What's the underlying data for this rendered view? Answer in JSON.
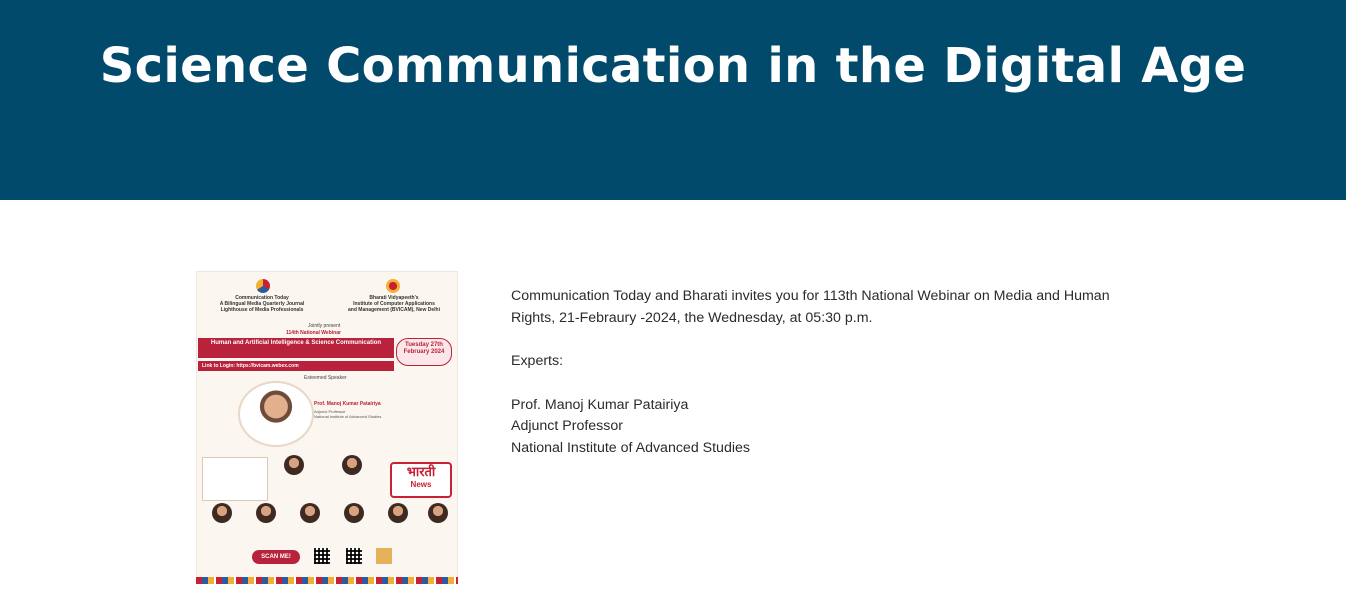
{
  "hero": {
    "title": "Science Communication in the Digital Age",
    "background_color": "#024a6b"
  },
  "poster": {
    "org_left": "Communication Today\nA Bilingual Media Quarterly Journal\nLighthouse of Media Professionals",
    "org_right": "Bharati Vidyapeeth's\nInstitute of Computer Applications\nand Management (BVICAM), New Delhi",
    "jointly": "Jointly present",
    "webinar_no": "114th National Webinar",
    "webinar_title": "Human and Artificial Intelligence & Science Communication",
    "date": "Tuesday 27th February 2024",
    "link": "Link to Login: https://bvicam.webex.com",
    "esteemed": "Esteemed Speaker",
    "speaker_name": "Prof. Manoj Kumar Patairiya",
    "speaker_role": "Adjunct Professor\nNational Institute of Advanced Studies",
    "scan": "SCAN ME!",
    "news_line1": "भारती",
    "news_line2": "News",
    "accent_color": "#b8223a"
  },
  "content": {
    "intro": "Communication Today and Bharati  invites you for 113th National Webinar on Media and Human Rights, 21-Febraury -2024, the Wednesday, at 05:30 p.m.",
    "experts_label": "Experts:",
    "expert_name": "Prof. Manoj Kumar Patairiya",
    "expert_role": "Adjunct Professor",
    "expert_org": "National Institute of Advanced Studies"
  }
}
